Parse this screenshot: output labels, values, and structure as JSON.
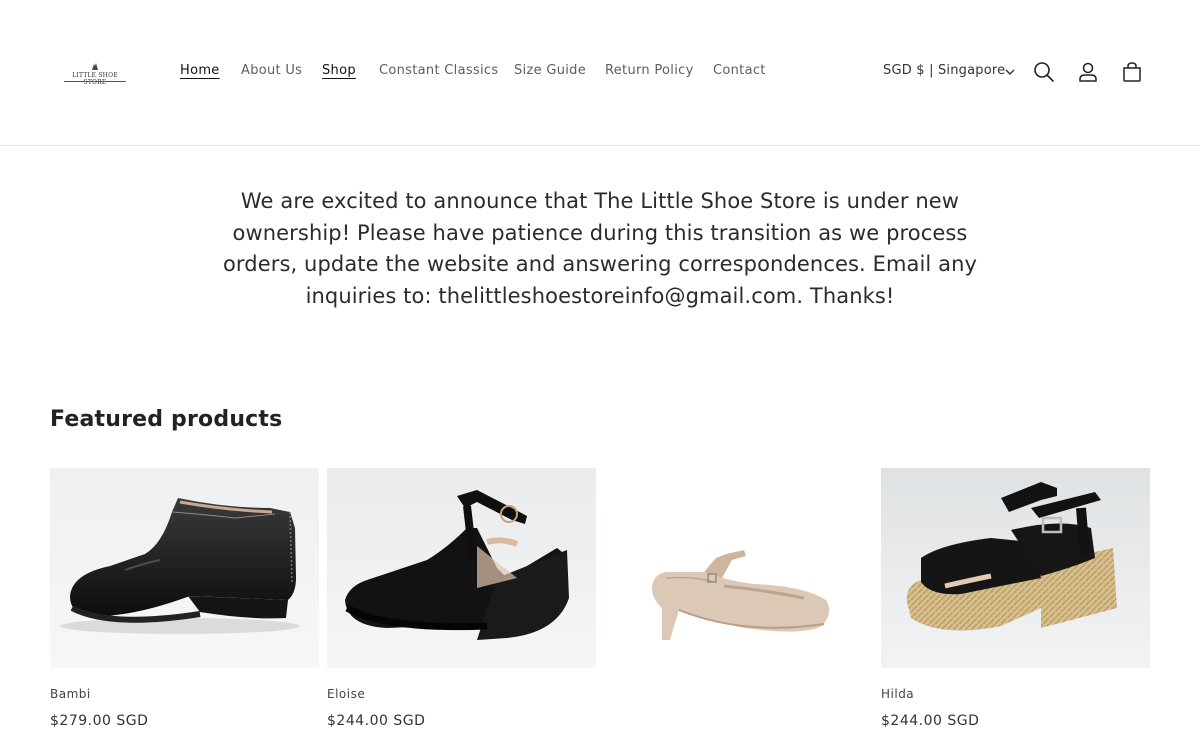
{
  "header": {
    "logo_text": "LITTLE SHOE STORE",
    "nav": [
      {
        "label": "Home",
        "active": true
      },
      {
        "label": "About Us",
        "active": false
      },
      {
        "label": "Shop",
        "active": true
      },
      {
        "label": "Constant Classics",
        "active": false
      },
      {
        "label": "Size Guide",
        "active": false
      },
      {
        "label": "Return Policy",
        "active": false
      },
      {
        "label": "Contact",
        "active": false
      }
    ],
    "locale": "SGD $ | Singapore",
    "icons": [
      "search-icon",
      "account-icon",
      "cart-icon"
    ]
  },
  "announcement": {
    "text": "We are excited to announce that The Little Shoe Store is under new ownership! Please have patience during this transition as we process orders, update the website and answering correspondences. Email any inquiries to: thelittleshoestoreinfo@gmail.com. Thanks!"
  },
  "featured": {
    "title": "Featured products",
    "products": [
      {
        "name": "Bambi",
        "price": "$279.00 SGD"
      },
      {
        "name": "Eloise",
        "price": "$244.00 SGD"
      },
      {
        "name": "",
        "price": ""
      },
      {
        "name": "Hilda",
        "price": "$244.00 SGD"
      }
    ]
  },
  "colors": {
    "text": "#121212",
    "muted": "#5e5e5e",
    "border": "#e8e8e8",
    "image_bg": "#eceeef"
  }
}
